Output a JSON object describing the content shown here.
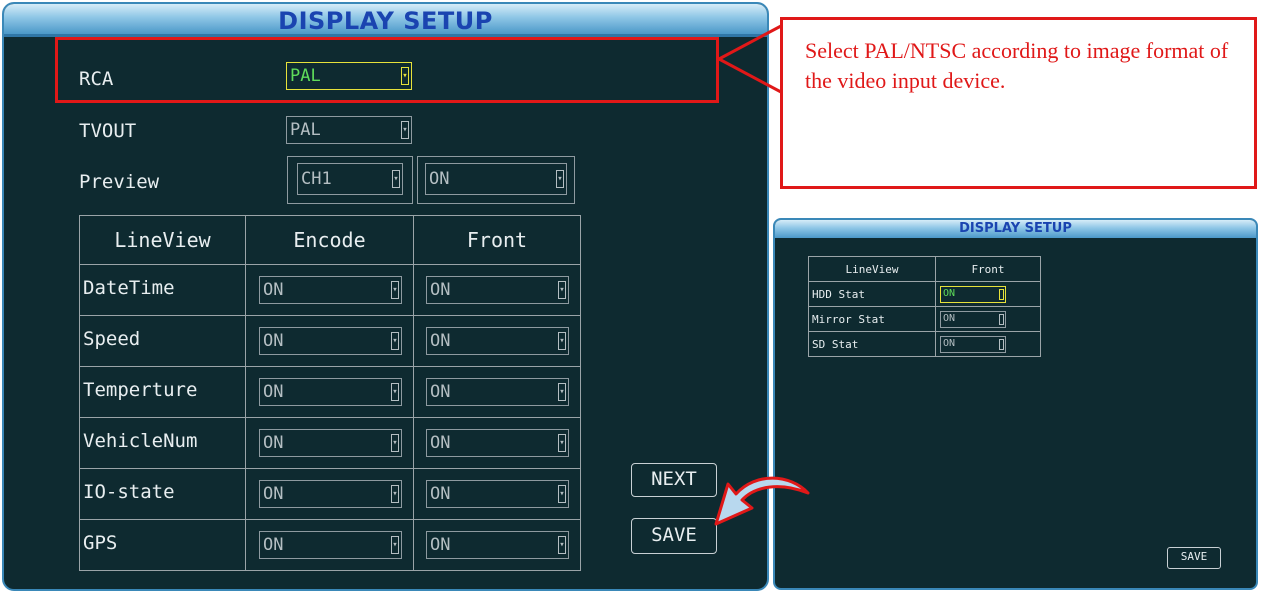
{
  "main": {
    "title": "DISPLAY SETUP",
    "rca": {
      "label": "RCA",
      "value": "PAL"
    },
    "tvout": {
      "label": "TVOUT",
      "value": "PAL"
    },
    "preview": {
      "label": "Preview",
      "channel": "CH1",
      "state": "ON"
    },
    "table": {
      "headers": [
        "LineView",
        "Encode",
        "Front"
      ],
      "rows": [
        {
          "label": "DateTime",
          "encode": "ON",
          "front": "ON"
        },
        {
          "label": "Speed",
          "encode": "ON",
          "front": "ON"
        },
        {
          "label": "Temperture",
          "encode": "ON",
          "front": "ON"
        },
        {
          "label": "VehicleNum",
          "encode": "ON",
          "front": "ON"
        },
        {
          "label": "IO-state",
          "encode": "ON",
          "front": "ON"
        },
        {
          "label": "GPS",
          "encode": "ON",
          "front": "ON"
        }
      ]
    },
    "next_label": "NEXT",
    "save_label": "SAVE"
  },
  "callout": {
    "text": "Select PAL/NTSC according to image format of the video input device."
  },
  "second": {
    "title": "DISPLAY SETUP",
    "headers": [
      "LineView",
      "Front"
    ],
    "rows": [
      {
        "label": "HDD Stat",
        "front": "ON"
      },
      {
        "label": "Mirror Stat",
        "front": "ON"
      },
      {
        "label": "SD Stat",
        "front": "ON"
      }
    ],
    "save_label": "SAVE"
  },
  "colors": {
    "background": "#0e2a30",
    "title_text": "#1a44b0",
    "highlight_border": "#e6e23a",
    "highlight_text": "#5fdc5a",
    "callout_red": "#e01818",
    "arrow_fill": "#b8d8ee"
  },
  "icons": {
    "dropdown_arrow": "dropdown-arrow-icon",
    "curved_arrow": "curved-arrow-icon"
  }
}
